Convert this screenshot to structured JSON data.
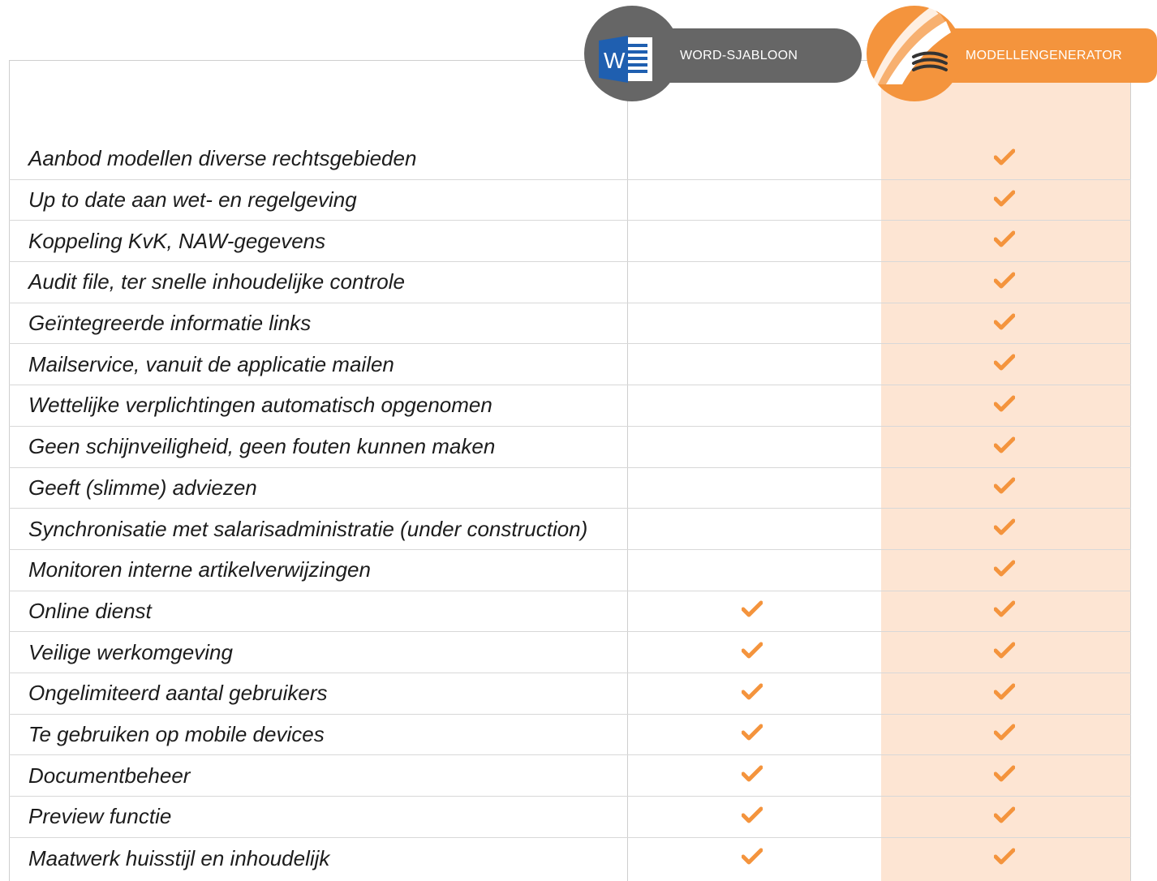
{
  "header": {
    "word_label": "WORD-SJABLOON",
    "generator_label": "MODELLENGENERATOR",
    "accent_color": "#f4943d",
    "word_color": "#666666",
    "highlight_color": "#fde5d3"
  },
  "rows": [
    {
      "label": "Aanbod modellen diverse rechtsgebieden",
      "word": false,
      "generator": true
    },
    {
      "label": "Up to date aan wet- en regelgeving",
      "word": false,
      "generator": true
    },
    {
      "label": "Koppeling KvK, NAW-gegevens",
      "word": false,
      "generator": true
    },
    {
      "label": "Audit file, ter snelle inhoudelijke controle",
      "word": false,
      "generator": true
    },
    {
      "label": "Geïntegreerde informatie links",
      "word": false,
      "generator": true
    },
    {
      "label": "Mailservice, vanuit de applicatie mailen",
      "word": false,
      "generator": true
    },
    {
      "label": "Wettelijke verplichtingen automatisch opgenomen",
      "word": false,
      "generator": true
    },
    {
      "label": "Geen schijnveiligheid, geen fouten kunnen maken",
      "word": false,
      "generator": true
    },
    {
      "label": "Geeft  (slimme) adviezen",
      "word": false,
      "generator": true
    },
    {
      "label": "Synchronisatie met salarisadministratie (under construction)",
      "word": false,
      "generator": true
    },
    {
      "label": "Monitoren interne artikelverwijzingen",
      "word": false,
      "generator": true
    },
    {
      "label": "Online dienst",
      "word": true,
      "generator": true
    },
    {
      "label": "Veilige werkomgeving",
      "word": true,
      "generator": true
    },
    {
      "label": "Ongelimiteerd aantal gebruikers",
      "word": true,
      "generator": true
    },
    {
      "label": "Te gebruiken op mobile devices",
      "word": true,
      "generator": true
    },
    {
      "label": "Documentbeheer",
      "word": true,
      "generator": true
    },
    {
      "label": "Preview functie",
      "word": true,
      "generator": true
    },
    {
      "label": "Maatwerk huisstijl en inhoudelijk",
      "word": true,
      "generator": true
    }
  ]
}
